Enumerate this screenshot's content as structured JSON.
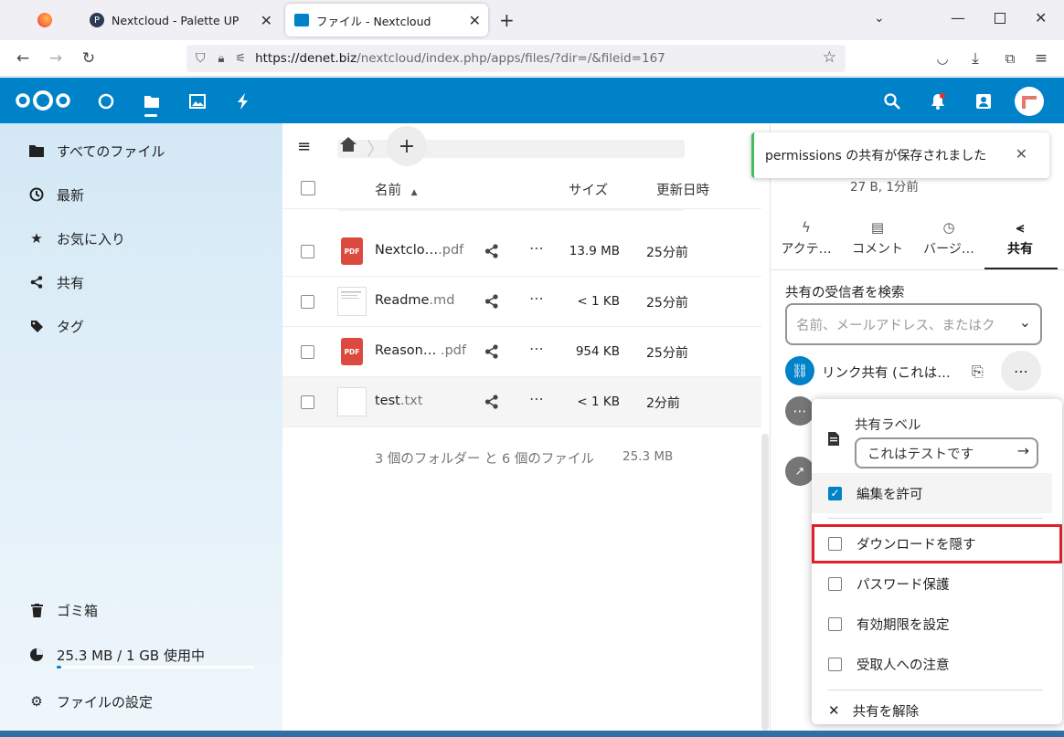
{
  "browser": {
    "tabs": [
      {
        "title": ""
      },
      {
        "title": "Nextcloud - Palette UP"
      },
      {
        "title": "ファイル - Nextcloud"
      }
    ],
    "url_host": "https://denet.biz",
    "url_path": "/nextcloud/index.php/apps/files/?dir=/&fileid=167"
  },
  "leftnav": {
    "items": [
      {
        "label": "すべてのファイル",
        "icon": "folder-icon"
      },
      {
        "label": "最新",
        "icon": "clock-icon"
      },
      {
        "label": "お気に入り",
        "icon": "star-icon"
      },
      {
        "label": "共有",
        "icon": "share-icon"
      },
      {
        "label": "タグ",
        "icon": "tag-icon"
      }
    ],
    "trash": "ゴミ箱",
    "quota": "25.3 MB / 1 GB 使用中",
    "quota_fraction": 0.025,
    "settings": "ファイルの設定"
  },
  "files": {
    "headers": {
      "name": "名前",
      "size": "サイズ",
      "modified": "更新日時"
    },
    "rows": [
      {
        "name": "Nextclo…",
        "ext": ".pdf",
        "size": "13.9 MB",
        "date": "25分前",
        "type": "pdf"
      },
      {
        "name": "Readme",
        "ext": ".md",
        "size": "< 1 KB",
        "date": "25分前",
        "type": "doc"
      },
      {
        "name": "Reason…",
        "ext": " .pdf",
        "size": "954 KB",
        "date": "25分前",
        "type": "pdf"
      },
      {
        "name": "test",
        "ext": ".txt",
        "size": "< 1 KB",
        "date": "2分前",
        "type": "txt"
      }
    ],
    "summary": "3 個のフォルダー と 6 個のファイル",
    "summary_size": "25.3 MB"
  },
  "toast": {
    "text": "permissions の共有が保存されました"
  },
  "sidebar": {
    "file_meta": "27 B, 1分前",
    "tabs": [
      {
        "label": "アクテ…",
        "icon": "activity-icon"
      },
      {
        "label": "コメント",
        "icon": "comment-icon"
      },
      {
        "label": "バージ…",
        "icon": "history-icon"
      },
      {
        "label": "共有",
        "icon": "share-icon"
      }
    ],
    "search_label": "共有の受信者を検索",
    "search_placeholder": "名前、メールアドレス、またはク",
    "link_share": "リンク共有 (これは…"
  },
  "menu": {
    "label_title": "共有ラベル",
    "label_value": "これはテストです",
    "items": [
      {
        "label": "編集を許可",
        "checked": true
      },
      {
        "label": "ダウンロードを隠す",
        "checked": false
      },
      {
        "label": "パスワード保護",
        "checked": false
      },
      {
        "label": "有効期限を設定",
        "checked": false
      },
      {
        "label": "受取人への注意",
        "checked": false
      }
    ],
    "unshare": "共有を解除"
  },
  "colors": {
    "brand": "#0082c9",
    "highlight": "#e0202a",
    "success": "#46ba61"
  }
}
